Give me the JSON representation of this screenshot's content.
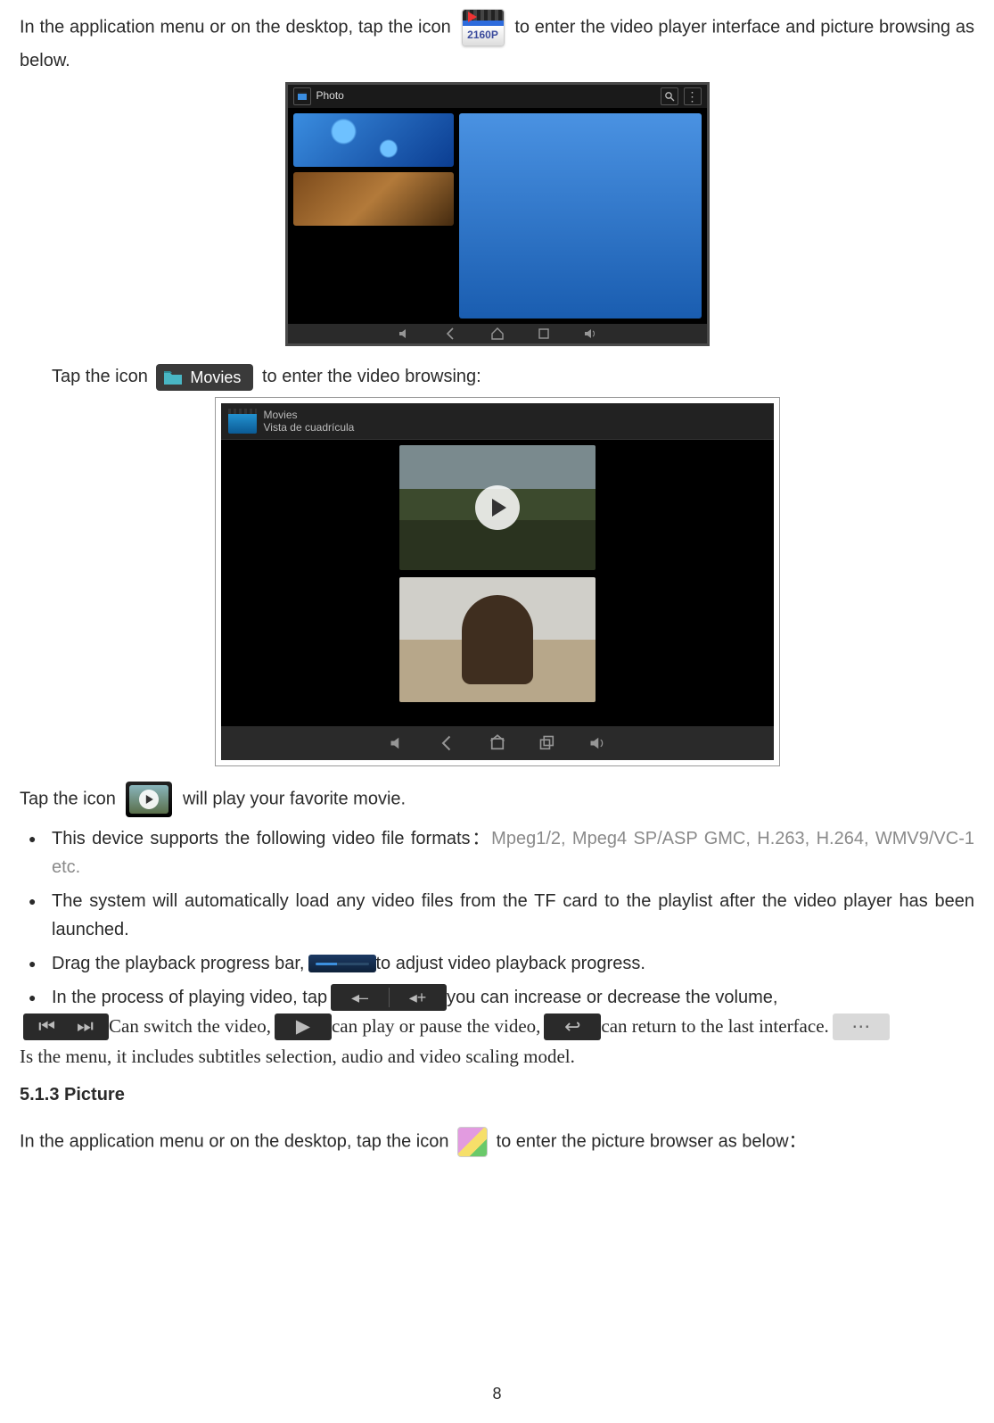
{
  "para1": {
    "a": "In the application menu or on the desktop, tap the icon ",
    "b": " to enter the video player interface and picture browsing as below."
  },
  "icon2160p": {
    "label": "2160P"
  },
  "shot1": {
    "title": "Photo",
    "menu_glyph": "⋮"
  },
  "para2": {
    "a": "Tap the icon ",
    "b": " to enter the video browsing:"
  },
  "movies_chip": {
    "label": "Movies"
  },
  "shot2": {
    "title": "Movies",
    "subtitle": "Vista de cuadrícula"
  },
  "para3": {
    "a": "Tap the icon ",
    "b": " will play your favorite movie."
  },
  "bullets": {
    "b1a": "This device supports the following video file formats：",
    "b1b": "Mpeg1/2, Mpeg4 SP/ASP GMC, H.263, H.264, WMV9/VC-1 etc.",
    "b2": "The system will automatically load any video files from the TF card to the playlist after the video player has been launched.",
    "b3a": "Drag the playback progress bar, ",
    "b3b": " to adjust video playback progress.",
    "b4a": "In the process of playing video, tap ",
    "b4b": " you can increase or decrease the volume, ",
    "b4c": " Can switch the video, ",
    "b4d": " can play or pause the video, ",
    "b4e": " can return to the last interface. ",
    "b4f": " Is the menu, it includes subtitles selection, audio and video scaling model."
  },
  "volchip": {
    "minus": "◂–",
    "plus": "◂+"
  },
  "ctrl_skip": {
    "prev": "⏮",
    "next": "⏭"
  },
  "ctrl_play_glyph": "▶",
  "ctrl_back_glyph": "↩",
  "ctrl_menu_glyph": "⋯",
  "section": "5.1.3 Picture",
  "para4": {
    "a": "In the application menu or on the desktop, tap the icon ",
    "b": " to enter the picture browser as below："
  },
  "pagenum": "8"
}
